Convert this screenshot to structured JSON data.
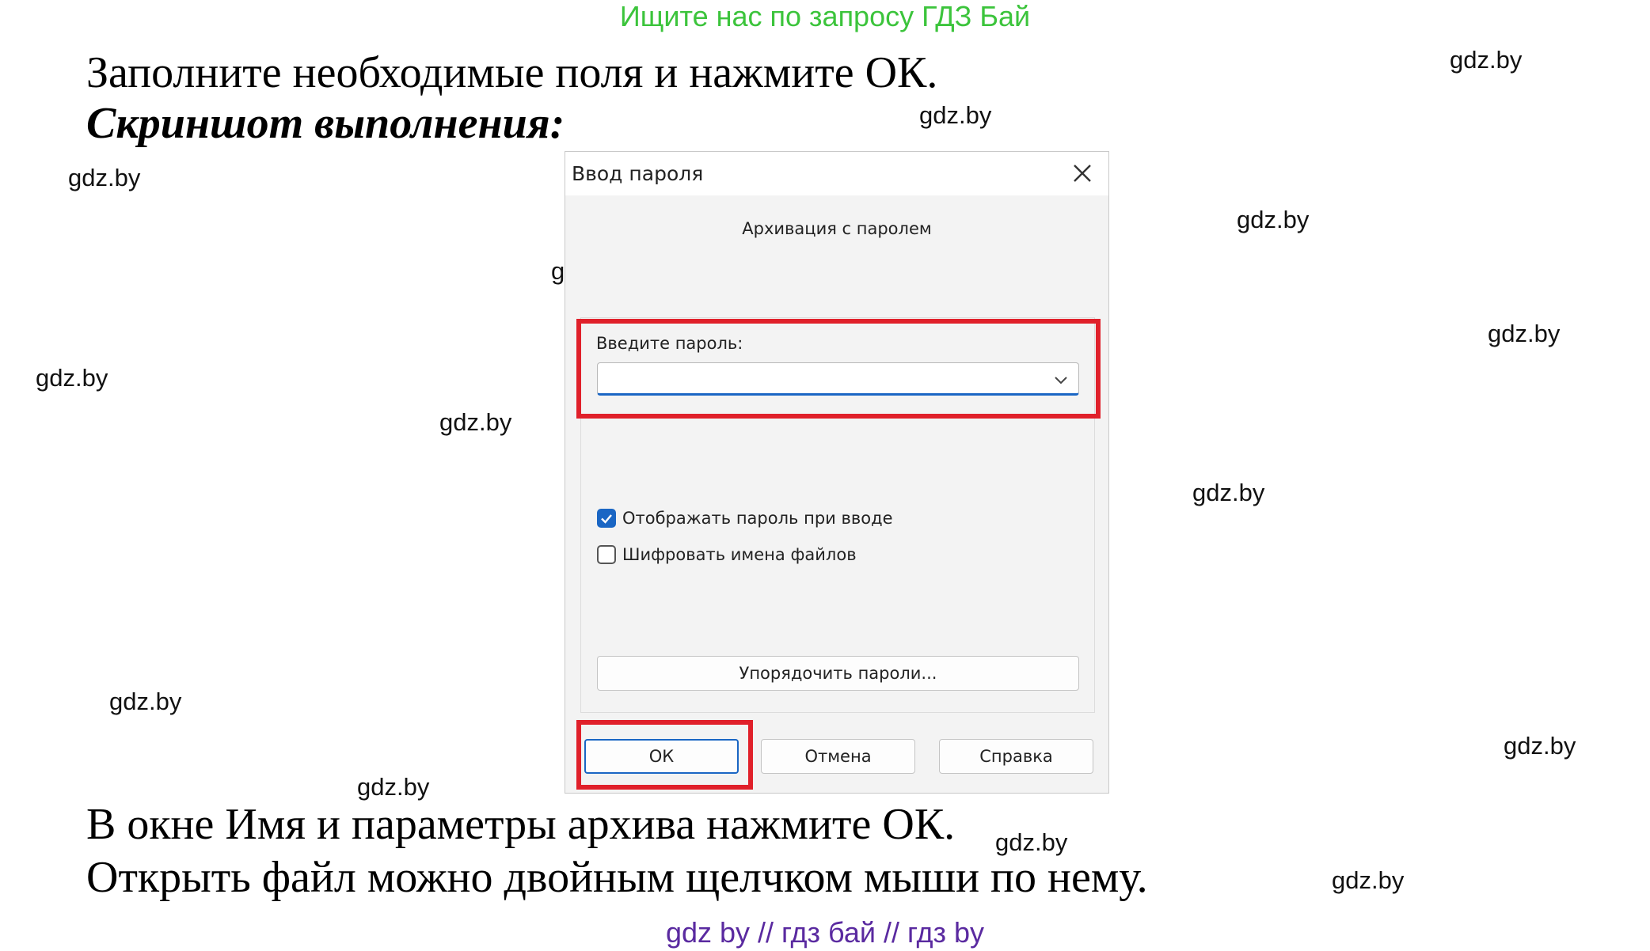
{
  "banner": "Ищите нас по запросу ГДЗ Бай",
  "instruction_top": "Заполните необходимые поля и нажмите ОК.",
  "screenshot_caption": "Скриншот выполнения:",
  "dialog": {
    "title": "Ввод пароля",
    "subtitle": "Архивация с паролем",
    "password_label": "Введите пароль:",
    "password_value": "",
    "show_password_label": "Отображать пароль при вводе",
    "show_password_checked": true,
    "encrypt_names_label": "Шифровать имена файлов",
    "encrypt_names_checked": false,
    "organize_button": "Упорядочить пароли...",
    "ok_button": "ОК",
    "cancel_button": "Отмена",
    "help_button": "Справка",
    "accent_color": "#1a66c4",
    "highlight_color": "#e0202a"
  },
  "instruction_bottom_1": "В окне Имя и параметры архива нажмите ОК.",
  "instruction_bottom_2": "Открыть файл можно двойным щелчком мыши по нему.",
  "watermark": "gdz.by",
  "footer": "gdz by  //  гдз бай  //  гдз by"
}
